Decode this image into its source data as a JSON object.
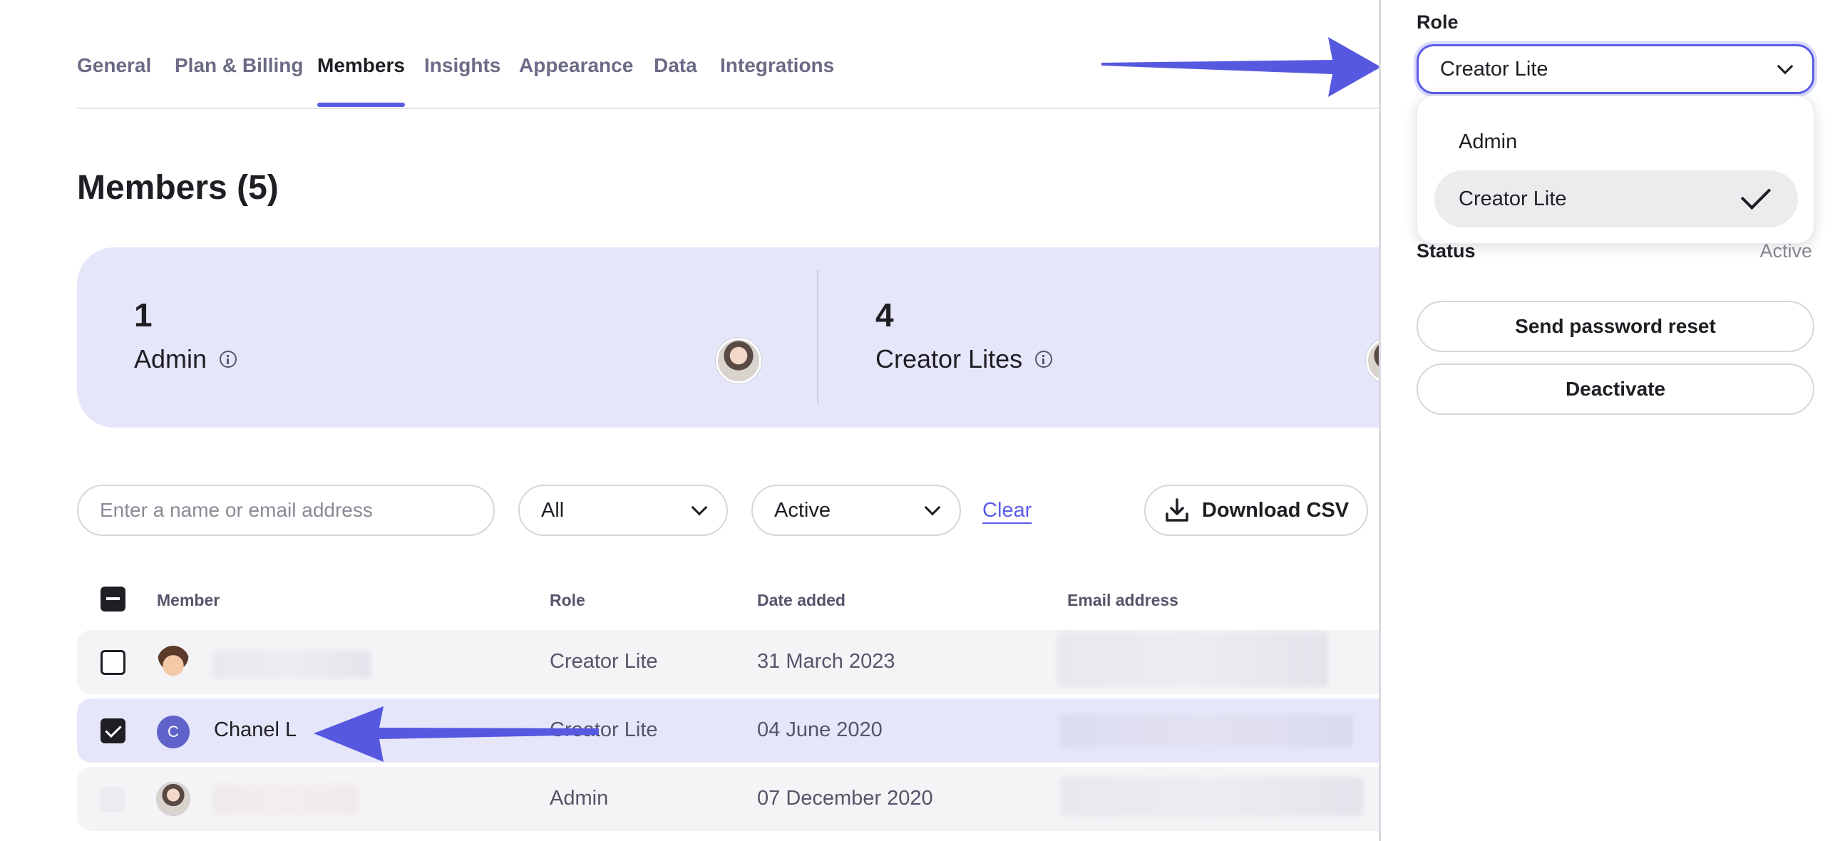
{
  "tabs": [
    {
      "label": "General"
    },
    {
      "label": "Plan & Billing"
    },
    {
      "label": "Members"
    },
    {
      "label": "Insights"
    },
    {
      "label": "Appearance"
    },
    {
      "label": "Data"
    },
    {
      "label": "Integrations"
    }
  ],
  "page": {
    "title": "Members (5)"
  },
  "summary": {
    "admin": {
      "count": "1",
      "label": "Admin"
    },
    "creator": {
      "count": "4",
      "label": "Creator Lites"
    }
  },
  "filters": {
    "search_placeholder": "Enter a name or email address",
    "role_value": "All",
    "status_value": "Active",
    "clear_label": "Clear",
    "download_label": "Download CSV"
  },
  "table": {
    "headers": {
      "member": "Member",
      "role": "Role",
      "date": "Date added",
      "email": "Email address"
    },
    "rows": [
      {
        "name": "",
        "initial": "",
        "role": "Creator Lite",
        "date": "31 March 2023",
        "checked": false
      },
      {
        "name": "Chanel L",
        "initial": "C",
        "role": "Creator Lite",
        "date": "04 June 2020",
        "checked": true
      },
      {
        "name": "",
        "initial": "",
        "role": "Admin",
        "date": "07 December 2020",
        "checked": false
      }
    ]
  },
  "panel": {
    "role_label": "Role",
    "role_value": "Creator Lite",
    "options": [
      {
        "label": "Admin",
        "selected": false
      },
      {
        "label": "Creator Lite",
        "selected": true
      }
    ],
    "status_label": "Status",
    "status_value": "Active",
    "send_reset_label": "Send password reset",
    "deactivate_label": "Deactivate"
  },
  "colors": {
    "accent": "#5b5ce6",
    "summary_bg": "#e6e6fa",
    "arrow": "#5658e0"
  }
}
